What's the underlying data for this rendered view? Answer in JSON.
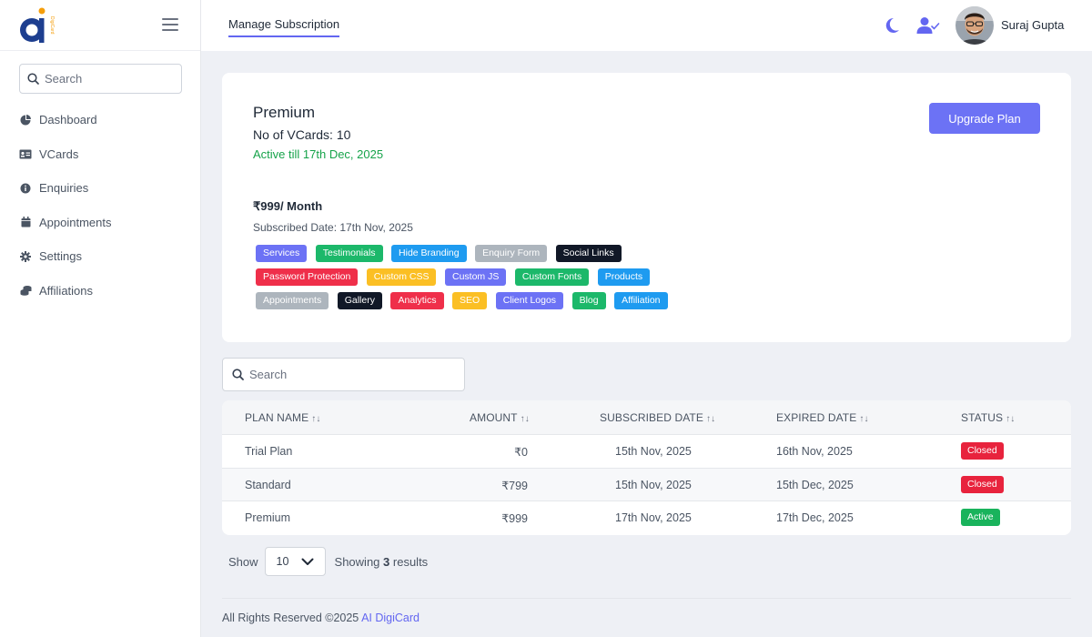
{
  "app": {
    "logo_text": "DigiCard"
  },
  "sidebar": {
    "search_placeholder": "Search",
    "items": [
      {
        "label": "Dashboard",
        "icon": "pie-chart-icon"
      },
      {
        "label": "VCards",
        "icon": "id-card-icon"
      },
      {
        "label": "Enquiries",
        "icon": "info-circle-icon"
      },
      {
        "label": "Appointments",
        "icon": "calendar-icon"
      },
      {
        "label": "Settings",
        "icon": "gear-icon"
      },
      {
        "label": "Affiliations",
        "icon": "coins-icon"
      }
    ]
  },
  "header": {
    "tab_label": "Manage Subscription",
    "user_name": "Suraj Gupta"
  },
  "plan": {
    "name": "Premium",
    "vcards": "No of VCards: 10",
    "active_till": "Active till 17th Dec, 2025",
    "upgrade_label": "Upgrade Plan",
    "price": "₹999/ Month",
    "subscribed_date": "Subscribed Date: 17th Nov, 2025",
    "feature_rows": [
      [
        {
          "label": "Services",
          "color": "#6c72f5"
        },
        {
          "label": "Testimonials",
          "color": "#1cb86a"
        },
        {
          "label": "Hide Branding",
          "color": "#1e9bf0"
        },
        {
          "label": "Enquiry Form",
          "color": "#adb5bd"
        },
        {
          "label": "Social Links",
          "color": "#111827"
        }
      ],
      [
        {
          "label": "Password Protection",
          "color": "#ef2f4a"
        },
        {
          "label": "Custom CSS",
          "color": "#fbbf24"
        },
        {
          "label": "Custom JS",
          "color": "#6c72f5"
        },
        {
          "label": "Custom Fonts",
          "color": "#1cb86a"
        },
        {
          "label": "Products",
          "color": "#1e9bf0"
        }
      ],
      [
        {
          "label": "Appointments",
          "color": "#adb5bd"
        },
        {
          "label": "Gallery",
          "color": "#111827"
        },
        {
          "label": "Analytics",
          "color": "#ef2f4a"
        },
        {
          "label": "SEO",
          "color": "#fbbf24"
        },
        {
          "label": "Client Logos",
          "color": "#6c72f5"
        },
        {
          "label": "Blog",
          "color": "#1cb86a"
        },
        {
          "label": "Affiliation",
          "color": "#1e9bf0"
        }
      ]
    ]
  },
  "table": {
    "search_placeholder": "Search",
    "columns": [
      "PLAN NAME",
      "AMOUNT",
      "SUBSCRIBED DATE",
      "EXPIRED DATE",
      "STATUS"
    ],
    "rows": [
      {
        "plan": "Trial Plan",
        "amount": "₹0",
        "subscribed": "15th Nov, 2025",
        "expired": "16th Nov, 2025",
        "status": "Closed",
        "status_color": "#e8233d"
      },
      {
        "plan": "Standard",
        "amount": "₹799",
        "subscribed": "15th Nov, 2025",
        "expired": "15th Dec, 2025",
        "status": "Closed",
        "status_color": "#e8233d"
      },
      {
        "plan": "Premium",
        "amount": "₹999",
        "subscribed": "17th Nov, 2025",
        "expired": "17th Dec, 2025",
        "status": "Active",
        "status_color": "#19b35c"
      }
    ]
  },
  "pagination": {
    "show_label": "Show",
    "per_page": "10",
    "showing_prefix": "Showing",
    "result_count": "3",
    "showing_suffix": "results"
  },
  "footer": {
    "text": "All Rights Reserved ©2025",
    "link": "AI DigiCard"
  },
  "colors": {
    "accent": "#6366f1",
    "success": "#16a34a",
    "danger": "#e8233d"
  }
}
